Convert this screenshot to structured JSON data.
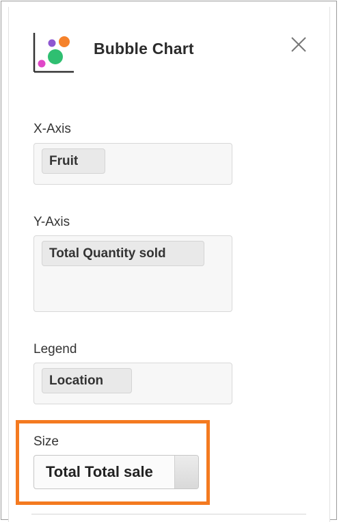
{
  "panel": {
    "title": "Bubble Chart",
    "icon": "bubble-chart-icon",
    "close_icon": "close-icon"
  },
  "fields": {
    "x_axis": {
      "label": "X-Axis",
      "value": "Fruit"
    },
    "y_axis": {
      "label": "Y-Axis",
      "value": "Total Quantity sold"
    },
    "legend": {
      "label": "Legend",
      "value": "Location"
    },
    "size": {
      "label": "Size",
      "value": "Total Total sale"
    }
  },
  "colors": {
    "highlight": "#f47a20",
    "bubble_orange": "#f5822b",
    "bubble_purple": "#8e57d1",
    "bubble_green": "#2fbf71",
    "bubble_pink": "#e048c8"
  }
}
